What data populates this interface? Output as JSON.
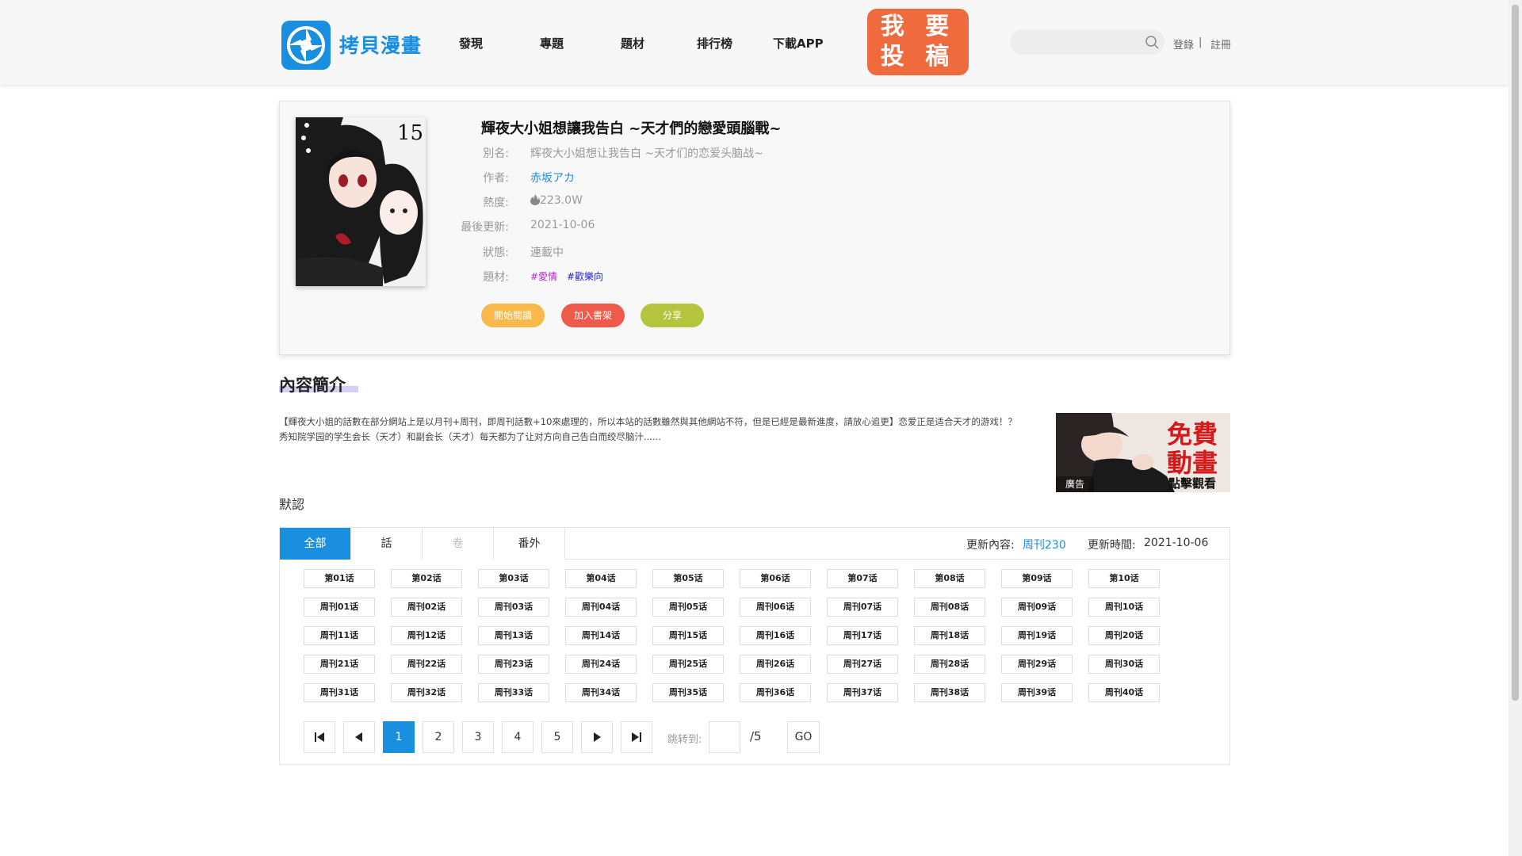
{
  "header": {
    "brand": "拷貝漫畫",
    "nav": [
      "發現",
      "專題",
      "題材",
      "排行榜",
      "下載APP"
    ],
    "submit_line1": "我 要",
    "submit_line2": "投 稿",
    "search_placeholder": "",
    "login": "登錄",
    "separator": "|",
    "register": "註冊"
  },
  "comic": {
    "cover_volume": "15",
    "title": "輝夜大小姐想讓我告白 ~天才們的戀愛頭腦戰~",
    "alias_label": "別名:",
    "alias": "辉夜大小姐想让我告白 ~天才们的恋爱头脑战~",
    "author_label": "作者:",
    "author": "赤坂アカ",
    "heat_label": "熱度:",
    "heat": "223.0W",
    "updated_label": "最後更新:",
    "updated": "2021-10-06",
    "status_label": "狀態:",
    "status": "連載中",
    "genre_label": "題材:",
    "tags": [
      "#愛情",
      "#歡樂向"
    ],
    "tag_colors": [
      "#c020e0",
      "#2222cc"
    ],
    "actions": [
      "開始閱讀",
      "加入書架",
      "分享"
    ],
    "action_colors": [
      "#f9b84a",
      "#f05a4a",
      "#b4c43c"
    ]
  },
  "intro": {
    "title": "內容簡介",
    "text": "【輝夜大小姐的話數在部分網站上是以月刊+周刊，即周刊話數+10來處理的，所以本站的話數雖然與其他網站不符，但是已經是最新進度，請放心追更】恋爱正是适合天才的游戏！？秀知院学园的学生会长（天才）和副会长（天才）每天都为了让对方向自己告白而绞尽脑汁......"
  },
  "ad": {
    "line1": "免費",
    "line2": "動畫",
    "line3": "點擊觀看",
    "tag": "廣告"
  },
  "default_label": "默認",
  "chapters": {
    "tabs": [
      "全部",
      "話",
      "卷",
      "番外"
    ],
    "update_content_label": "更新內容:",
    "update_content": "周刊230",
    "update_time_label": "更新時間:",
    "update_time": "2021-10-06",
    "items": [
      "第01话",
      "第02话",
      "第03话",
      "第04话",
      "第05话",
      "第06话",
      "第07话",
      "第08话",
      "第09话",
      "第10话",
      "周刊01话",
      "周刊02话",
      "周刊03话",
      "周刊04话",
      "周刊05话",
      "周刊06话",
      "周刊07话",
      "周刊08话",
      "周刊09话",
      "周刊10话",
      "周刊11话",
      "周刊12话",
      "周刊13话",
      "周刊14话",
      "周刊15话",
      "周刊16话",
      "周刊17话",
      "周刊18话",
      "周刊19话",
      "周刊20话",
      "周刊21话",
      "周刊22话",
      "周刊23话",
      "周刊24话",
      "周刊25话",
      "周刊26话",
      "周刊27话",
      "周刊28话",
      "周刊29话",
      "周刊30话",
      "周刊31话",
      "周刊32话",
      "周刊33话",
      "周刊34话",
      "周刊35话",
      "周刊36话",
      "周刊37话",
      "周刊38话",
      "周刊39话",
      "周刊40话"
    ]
  },
  "pagination": {
    "pages": [
      "1",
      "2",
      "3",
      "4",
      "5"
    ],
    "current": "1",
    "jump_label": "跳转到:",
    "total": "/5",
    "go": "GO"
  }
}
